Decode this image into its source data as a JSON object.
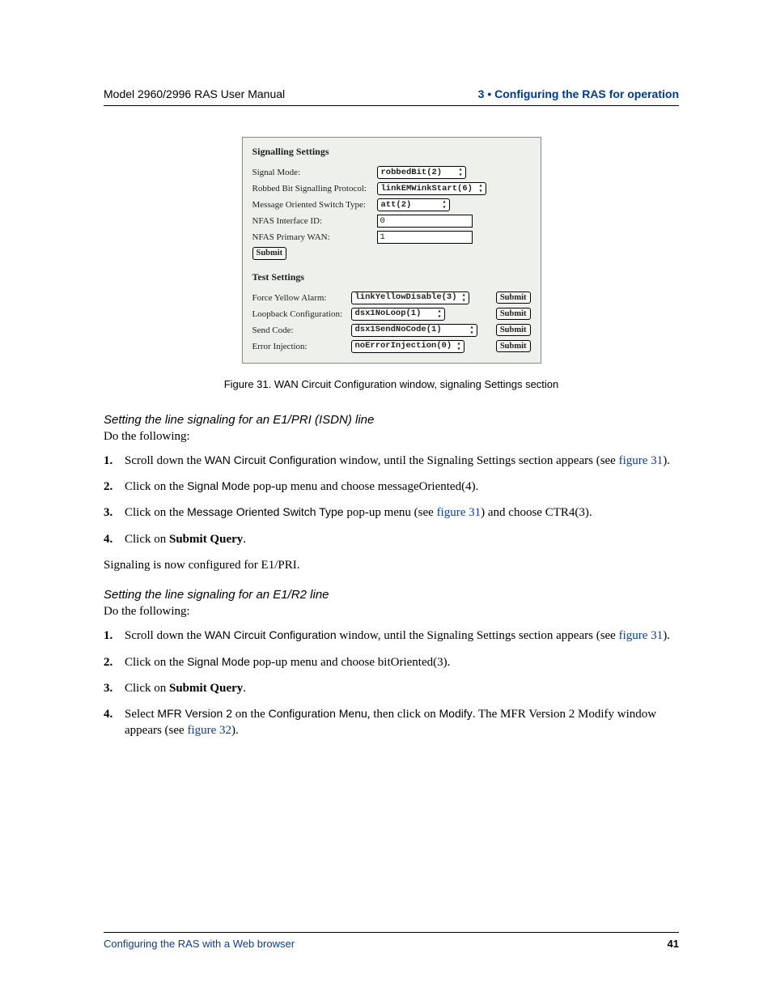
{
  "header": {
    "left": "Model 2960/2996 RAS User Manual",
    "right": "3 • Configuring the RAS for operation"
  },
  "figure": {
    "signalling_title": "Signalling Settings",
    "rows": {
      "signal_mode_label": "Signal Mode:",
      "signal_mode_value": "robbedBit(2)",
      "rbsp_label": "Robbed Bit Signalling Protocol:",
      "rbsp_value": "linkEMWinkStart(6)",
      "most_label": "Message Oriented Switch Type:",
      "most_value": "att(2)",
      "nfas_id_label": "NFAS Interface ID:",
      "nfas_id_value": "0",
      "nfas_primary_label": "NFAS Primary WAN:",
      "nfas_primary_value": "1"
    },
    "submit": "Submit",
    "test_title": "Test Settings",
    "test": {
      "force_yellow_label": "Force Yellow Alarm:",
      "force_yellow_value": "linkYellowDisable(3)",
      "loopback_label": "Loopback Configuration:",
      "loopback_value": "dsx1NoLoop(1)",
      "send_code_label": "Send Code:",
      "send_code_value": "dsx1SendNoCode(1)",
      "error_inj_label": "Error Injection:",
      "error_inj_value": "noErrorInjection(0)"
    },
    "submit_btn": "Submit",
    "caption": "Figure 31. WAN Circuit Configuration window, signaling Settings section"
  },
  "section1": {
    "heading": "Setting the line signaling for an E1/PRI (ISDN) line",
    "intro": "Do the following:",
    "step1_a": "Scroll down the ",
    "step1_b": "WAN Circuit Configuration",
    "step1_c": " window, until the Signaling Settings section appears (see ",
    "step1_link": "figure 31",
    "step1_d": ").",
    "step2_a": "Click on the ",
    "step2_b": "Signal Mode",
    "step2_c": " pop-up menu and choose messageOriented(4).",
    "step3_a": "Click on the ",
    "step3_b": "Message Oriented Switch Type",
    "step3_c": " pop-up menu (see ",
    "step3_link": "figure 31",
    "step3_d": ") and choose CTR4(3).",
    "step4_a": "Click on ",
    "step4_b": "Submit Query",
    "step4_c": ".",
    "outro": "Signaling is now configured for E1/PRI."
  },
  "section2": {
    "heading": "Setting the line signaling for an E1/R2 line",
    "intro": "Do the following:",
    "step1_a": "Scroll down the ",
    "step1_b": "WAN Circuit Configuration",
    "step1_c": " window, until the Signaling Settings section appears (see ",
    "step1_link": "figure 31",
    "step1_d": ").",
    "step2_a": "Click on the ",
    "step2_b": "Signal Mode",
    "step2_c": " pop-up menu and choose bitOriented(3).",
    "step3_a": "Click on ",
    "step3_b": "Submit Query",
    "step3_c": ".",
    "step4_a": "Select ",
    "step4_b": "MFR Version 2",
    "step4_c": " on the ",
    "step4_d": "Configuration Menu",
    "step4_e": ", then click on ",
    "step4_f": "Modify",
    "step4_g": ". The MFR Version 2 Modify window appears (see ",
    "step4_link": "figure 32",
    "step4_h": ")."
  },
  "footer": {
    "left": "Configuring the RAS with a Web browser",
    "right": "41"
  }
}
